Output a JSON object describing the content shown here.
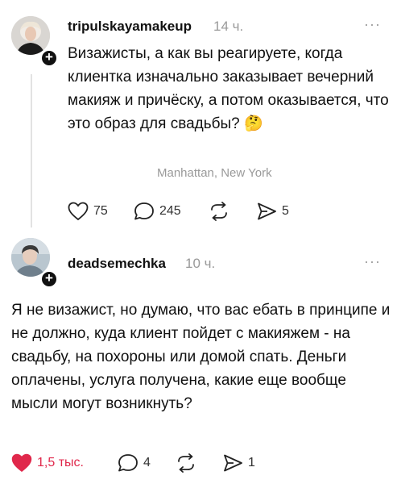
{
  "post1": {
    "username": "tripulskayamakeup",
    "time": "14 ч.",
    "more": "···",
    "text": "Визажисты, а как вы реагируете, когда клиентка изначально заказывает вечерний макияж и причёску, а потом оказывается, что это образ для свадьбы? 🤔",
    "location": "Manhattan, New York",
    "likes": "75",
    "replies": "245",
    "shares": "5"
  },
  "post2": {
    "username": "deadsemechka",
    "time": "10 ч.",
    "more": "···",
    "text": "Я не визажист, но думаю, что вас ебать в принципе и не должно, куда клиент пойдет с макияжем - на свадьбу, на похороны или домой спать. Деньги оплачены, услуга получена, какие еще вообще мысли могут возникнуть?",
    "likes": "1,5 тыс.",
    "replies": "4",
    "shares": "1"
  },
  "icons": {
    "heart": "heart-icon",
    "heart_filled": "heart-filled-icon",
    "reply": "speech-bubble-icon",
    "repost": "repost-icon",
    "share": "send-icon",
    "follow": "plus-icon",
    "more": "more-dots-icon"
  },
  "colors": {
    "liked": "#e0284b",
    "muted": "#9a9a9a",
    "text": "#111111"
  }
}
